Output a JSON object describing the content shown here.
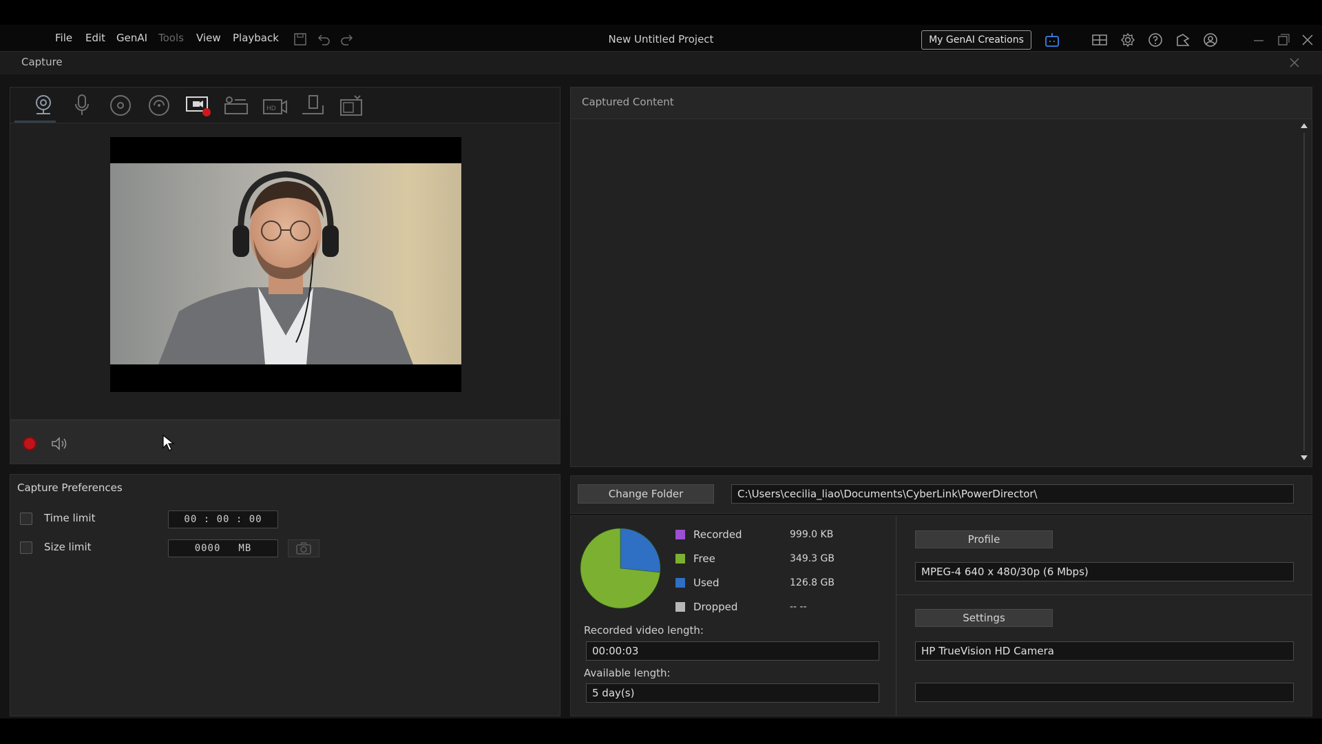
{
  "menu": {
    "items": [
      "File",
      "Edit",
      "GenAI",
      "Tools",
      "View",
      "Playback"
    ],
    "project_title": "New Untitled Project",
    "genai_button": "My GenAI Creations"
  },
  "capture": {
    "title": "Capture",
    "mode_icons": [
      "webcam-capture-icon",
      "microphone-capture-icon",
      "cd-capture-icon",
      "dvd-capture-icon",
      "screen-record-icon",
      "tv-capture-icon",
      "hdv-camcorder-icon",
      "mobile-device-icon",
      "dv-camcorder-icon"
    ],
    "selected_mode": "webcam-capture-icon"
  },
  "preferences": {
    "title": "Capture Preferences",
    "time_limit_label": "Time limit",
    "time_limit_value": "00 : 00 : 00",
    "size_limit_label": "Size limit",
    "size_limit_value": "0000",
    "size_limit_unit": "MB"
  },
  "captured_content": {
    "title": "Captured Content",
    "change_folder_label": "Change Folder",
    "folder_path": "C:\\Users\\cecilia_liao\\Documents\\CyberLink\\PowerDirector\\"
  },
  "stats": {
    "legend": [
      {
        "label": "Recorded",
        "value": "999.0  KB",
        "color": "#9b4fd1"
      },
      {
        "label": "Free",
        "value": "349.3  GB",
        "color": "#7cb030"
      },
      {
        "label": "Used",
        "value": "126.8  GB",
        "color": "#2f6fc4"
      },
      {
        "label": "Dropped",
        "value": "-- --",
        "color": "#b8b8b8"
      }
    ],
    "recorded_length_label": "Recorded video length:",
    "recorded_length_value": "00:00:03",
    "available_length_label": "Available length:",
    "available_length_value": "5 day(s)",
    "profile_label": "Profile",
    "profile_value": "MPEG-4 640 x 480/30p (6 Mbps)",
    "settings_label": "Settings",
    "device_value": "HP TrueVision HD Camera",
    "extra_value": ""
  },
  "chart_data": {
    "type": "pie",
    "categories": [
      "Free",
      "Used"
    ],
    "values": [
      349.3,
      126.8
    ],
    "colors": [
      "#7cb030",
      "#2f6fc4"
    ]
  }
}
